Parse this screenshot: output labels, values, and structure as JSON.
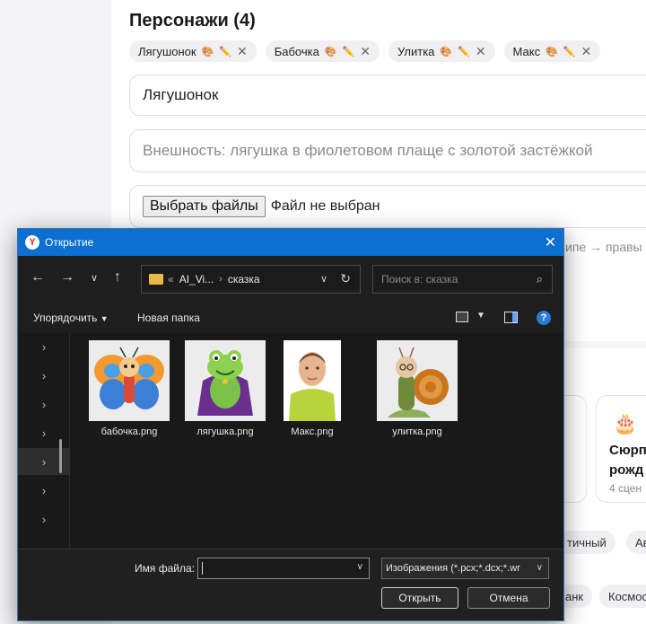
{
  "page": {
    "section_title": "Персонажи (4)",
    "characters": [
      {
        "name": "Лягушонок"
      },
      {
        "name": "Бабочка"
      },
      {
        "name": "Улитка"
      },
      {
        "name": "Макс"
      }
    ],
    "name_value": "Лягушонок",
    "appearance_placeholder": "Внешность: лягушка в фиолетовом плаще с золотой застёжкой",
    "file_button": "Выбрать файлы",
    "file_status": "Файл не выбран",
    "hint_text": "ипе → правы",
    "card": {
      "title": "Сюрп рожд",
      "subtitle": "4 сцен"
    },
    "tags": [
      "тичный",
      "Ав",
      "анк",
      "Космос"
    ]
  },
  "dialog": {
    "title": "Открытие",
    "breadcrumb": [
      "AI_Vi...",
      "сказка"
    ],
    "breadcrumb_prefix": "«",
    "search_placeholder": "Поиск в: сказка",
    "organize_label": "Упорядочить",
    "new_folder_label": "Новая папка",
    "files": [
      {
        "name": "бабочка.png"
      },
      {
        "name": "лягушка.png"
      },
      {
        "name": "Макс.png"
      },
      {
        "name": "улитка.png"
      }
    ],
    "filename_label": "Имя файла:",
    "filename_value": "",
    "filetype_value": "Изображения (*.pcx;*.dcx;*.wr",
    "open_button": "Открыть",
    "cancel_button": "Отмена"
  }
}
